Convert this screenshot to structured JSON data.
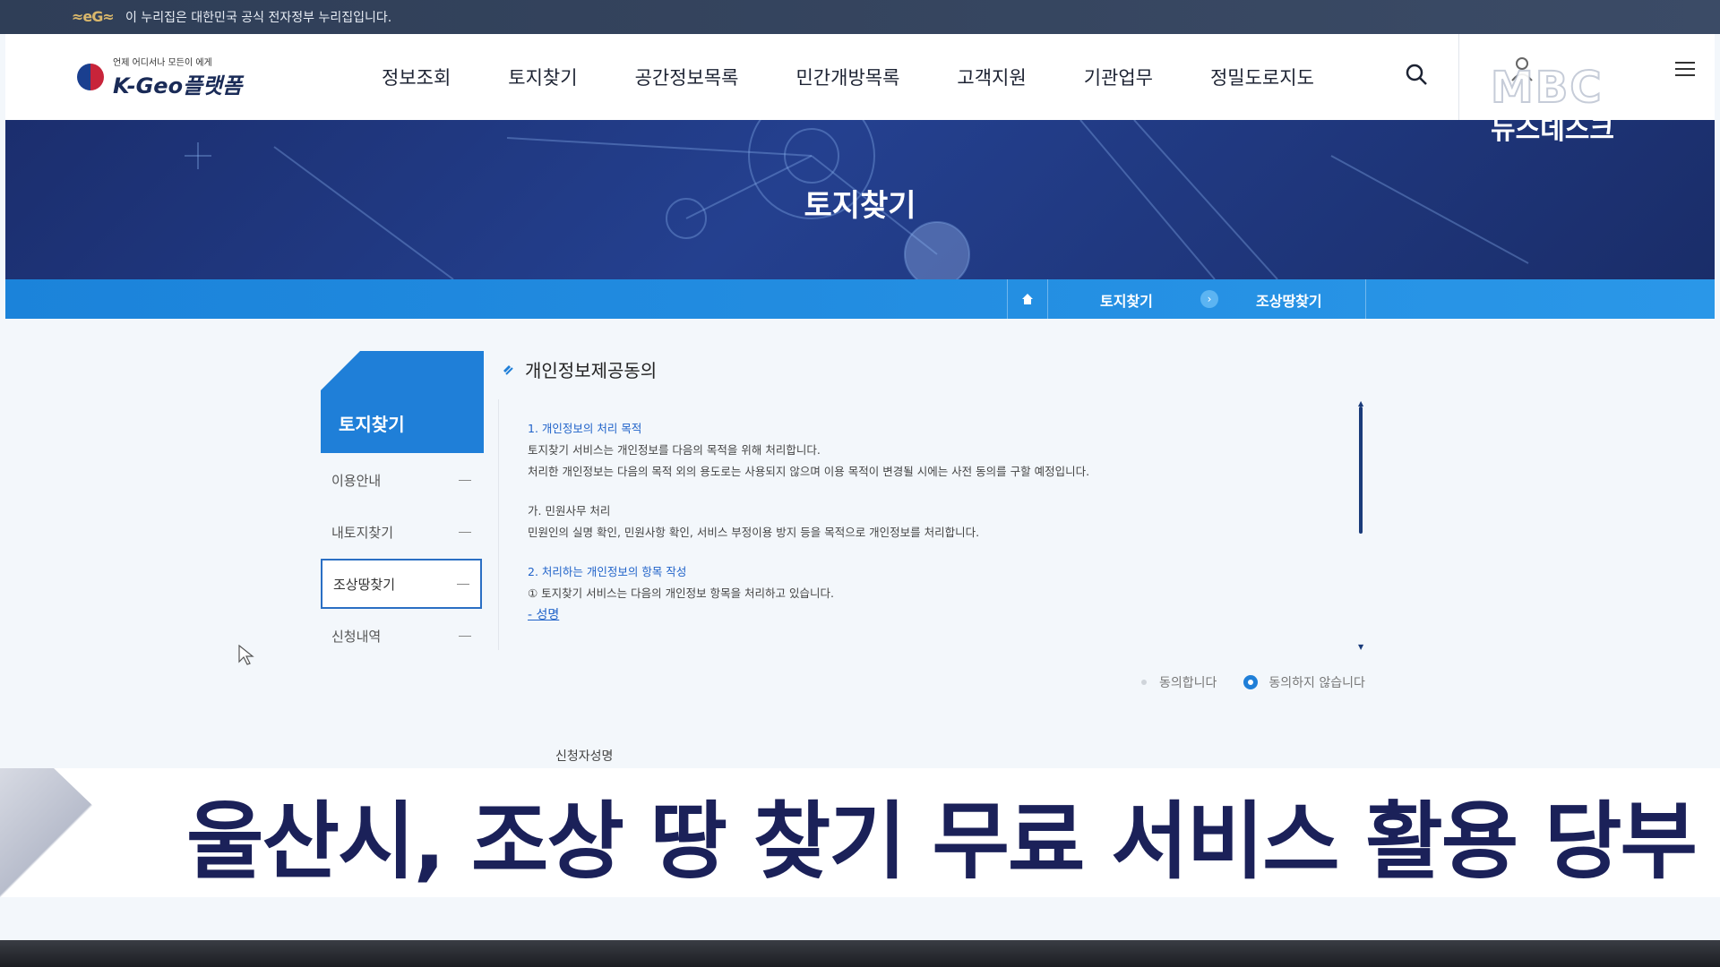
{
  "gov_strip": {
    "notice": "이 누리집은 대한민국 공식 전자정부 누리집입니다."
  },
  "header": {
    "logo_tag": "언제 어디서나 모든이 에게",
    "logo_name": "K-Geo플랫폼",
    "nav": [
      "정보조회",
      "토지찾기",
      "공간정보목록",
      "민간개방목록",
      "고객지원",
      "기관업무",
      "정밀도로지도"
    ]
  },
  "hero": {
    "title": "토지찾기"
  },
  "breadcrumb": {
    "level1": "토지찾기",
    "level2": "조상땅찾기"
  },
  "sidebar": {
    "title": "토지찾기",
    "items": [
      "이용안내",
      "내토지찾기",
      "조상땅찾기",
      "신청내역"
    ],
    "active_index": 2
  },
  "content": {
    "section_title": "개인정보제공동의",
    "terms": [
      "1. 개인정보의 처리 목적",
      "토지찾기 서비스는 개인정보를 다음의 목적을 위해 처리합니다.",
      "처리한 개인정보는 다음의 목적 외의 용도로는 사용되지 않으며 이용 목적이 변경될 시에는 사전 동의를 구할 예정입니다.",
      "가. 민원사무 처리",
      "민원인의 실명 확인, 민원사항 확인, 서비스 부정이용 방지 등을 목적으로 개인정보를 처리합니다.",
      "2. 처리하는 개인정보의 항목 작성",
      "① 토지찾기 서비스는 다음의 개인정보 항목을 처리하고 있습니다.",
      "- 성명"
    ],
    "agree_label": "동의합니다",
    "disagree_label": "동의하지 않습니다",
    "selected": "disagree",
    "applicant_label": "신청자성명"
  },
  "watermark": {
    "brand": "MBC",
    "program": "뉴스데스크"
  },
  "caption": {
    "headline": "울산시, 조상 땅 찾기 무료 서비스 활용 당부"
  },
  "colors": {
    "primary_blue": "#1f7fd8",
    "navy": "#1b2e6e",
    "caption_text": "#1b2159"
  }
}
